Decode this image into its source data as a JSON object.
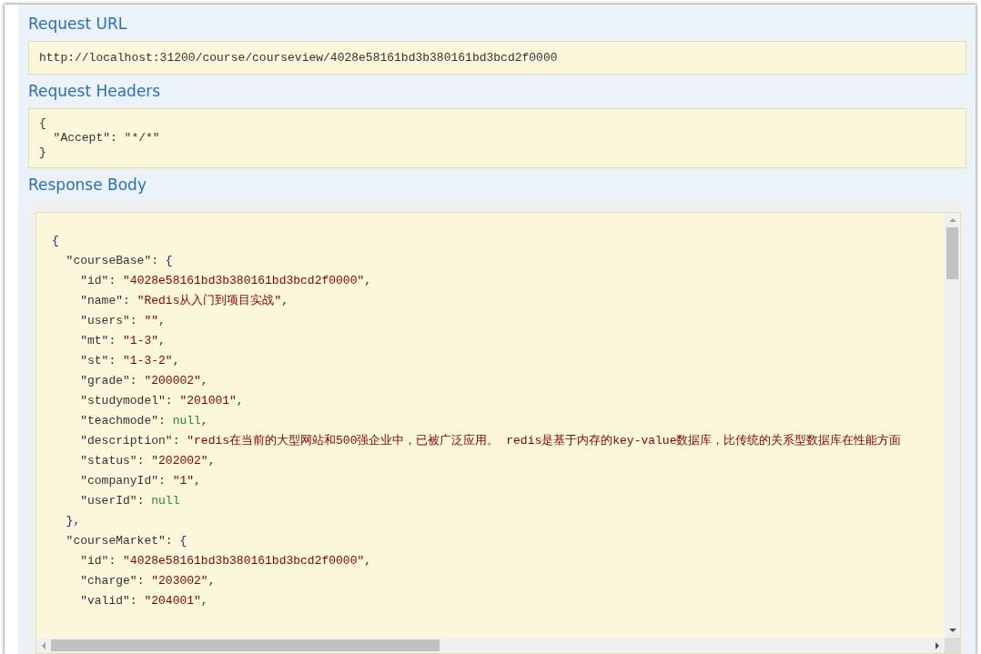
{
  "request_url": {
    "title": "Request URL",
    "value": "http://localhost:31200/course/courseview/4028e58161bd3b380161bd3bcd2f0000"
  },
  "request_headers": {
    "title": "Request Headers",
    "lines": [
      "{",
      "  \"Accept\": \"*/*\"",
      "}"
    ]
  },
  "response_body": {
    "title": "Response Body",
    "lines": [
      [
        {
          "kind": "punct",
          "text": "{"
        }
      ],
      [
        {
          "kind": "key",
          "text": "  \"courseBase\""
        },
        {
          "kind": "plain",
          "text": ": "
        },
        {
          "kind": "punct",
          "text": "{"
        }
      ],
      [
        {
          "kind": "key",
          "text": "    \"id\""
        },
        {
          "kind": "plain",
          "text": ": "
        },
        {
          "kind": "string",
          "text": "\"4028e58161bd3b380161bd3bcd2f0000\""
        },
        {
          "kind": "plain",
          "text": ","
        }
      ],
      [
        {
          "kind": "key",
          "text": "    \"name\""
        },
        {
          "kind": "plain",
          "text": ": "
        },
        {
          "kind": "string",
          "text": "\"Redis从入门到项目实战\""
        },
        {
          "kind": "plain",
          "text": ","
        }
      ],
      [
        {
          "kind": "key",
          "text": "    \"users\""
        },
        {
          "kind": "plain",
          "text": ": "
        },
        {
          "kind": "string",
          "text": "\"\""
        },
        {
          "kind": "plain",
          "text": ","
        }
      ],
      [
        {
          "kind": "key",
          "text": "    \"mt\""
        },
        {
          "kind": "plain",
          "text": ": "
        },
        {
          "kind": "string",
          "text": "\"1-3\""
        },
        {
          "kind": "plain",
          "text": ","
        }
      ],
      [
        {
          "kind": "key",
          "text": "    \"st\""
        },
        {
          "kind": "plain",
          "text": ": "
        },
        {
          "kind": "string",
          "text": "\"1-3-2\""
        },
        {
          "kind": "plain",
          "text": ","
        }
      ],
      [
        {
          "kind": "key",
          "text": "    \"grade\""
        },
        {
          "kind": "plain",
          "text": ": "
        },
        {
          "kind": "string",
          "text": "\"200002\""
        },
        {
          "kind": "plain",
          "text": ","
        }
      ],
      [
        {
          "kind": "key",
          "text": "    \"studymodel\""
        },
        {
          "kind": "plain",
          "text": ": "
        },
        {
          "kind": "string",
          "text": "\"201001\""
        },
        {
          "kind": "plain",
          "text": ","
        }
      ],
      [
        {
          "kind": "key",
          "text": "    \"teachmode\""
        },
        {
          "kind": "plain",
          "text": ": "
        },
        {
          "kind": "null",
          "text": "null"
        },
        {
          "kind": "plain",
          "text": ","
        }
      ],
      [
        {
          "kind": "key",
          "text": "    \"description\""
        },
        {
          "kind": "plain",
          "text": ": "
        },
        {
          "kind": "string",
          "text": "\"redis在当前的大型网站和500强企业中，已被广泛应用。 redis是基于内存的key-value数据库，比传统的关系型数据库在性能方面"
        }
      ],
      [
        {
          "kind": "key",
          "text": "    \"status\""
        },
        {
          "kind": "plain",
          "text": ": "
        },
        {
          "kind": "string",
          "text": "\"202002\""
        },
        {
          "kind": "plain",
          "text": ","
        }
      ],
      [
        {
          "kind": "key",
          "text": "    \"companyId\""
        },
        {
          "kind": "plain",
          "text": ": "
        },
        {
          "kind": "string",
          "text": "\"1\""
        },
        {
          "kind": "plain",
          "text": ","
        }
      ],
      [
        {
          "kind": "key",
          "text": "    \"userId\""
        },
        {
          "kind": "plain",
          "text": ": "
        },
        {
          "kind": "null",
          "text": "null"
        }
      ],
      [
        {
          "kind": "punct",
          "text": "  },"
        }
      ],
      [
        {
          "kind": "key",
          "text": "  \"courseMarket\""
        },
        {
          "kind": "plain",
          "text": ": "
        },
        {
          "kind": "punct",
          "text": "{"
        }
      ],
      [
        {
          "kind": "key",
          "text": "    \"id\""
        },
        {
          "kind": "plain",
          "text": ": "
        },
        {
          "kind": "string",
          "text": "\"4028e58161bd3b380161bd3bcd2f0000\""
        },
        {
          "kind": "plain",
          "text": ","
        }
      ],
      [
        {
          "kind": "key",
          "text": "    \"charge\""
        },
        {
          "kind": "plain",
          "text": ": "
        },
        {
          "kind": "string",
          "text": "\"203002\""
        },
        {
          "kind": "plain",
          "text": ","
        }
      ],
      [
        {
          "kind": "key",
          "text": "    \"valid\""
        },
        {
          "kind": "plain",
          "text": ": "
        },
        {
          "kind": "string",
          "text": "\"204001\""
        },
        {
          "kind": "plain",
          "text": ","
        }
      ]
    ]
  }
}
